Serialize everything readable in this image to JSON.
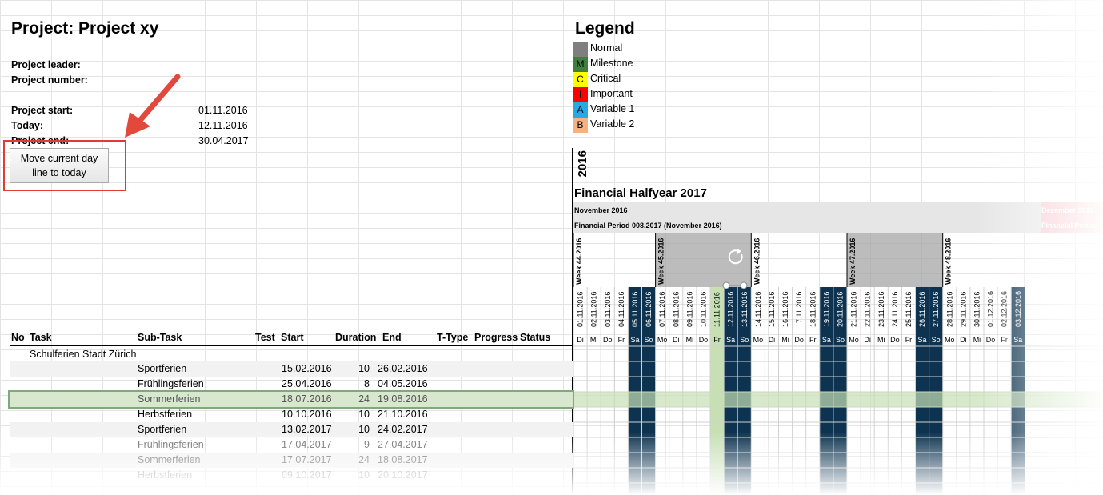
{
  "project": {
    "title": "Project: Project xy",
    "leader_label": "Project leader:",
    "number_label": "Project number:",
    "start_label": "Project start:",
    "start_value": "01.11.2016",
    "today_label": "Today:",
    "today_value": "12.11.2016",
    "end_label": "Project end:",
    "end_value": "30.04.2017"
  },
  "button": {
    "line1": "Move current day",
    "line2": "line to today"
  },
  "legend": {
    "title": "Legend",
    "items": [
      {
        "code": "",
        "label": "Normal",
        "color": "#7f7f7f"
      },
      {
        "code": "M",
        "label": "Milestone",
        "color": "#3e7f3e"
      },
      {
        "code": "C",
        "label": "Critical",
        "color": "#ffff00"
      },
      {
        "code": "I",
        "label": "Important",
        "color": "#ff0000"
      },
      {
        "code": "A",
        "label": "Variable 1",
        "color": "#2aa9e0"
      },
      {
        "code": "B",
        "label": "Variable 2",
        "color": "#f4b183"
      }
    ]
  },
  "gantt": {
    "year": "2016",
    "halfyear": "Financial Halfyear 2017",
    "month": "November 2016",
    "month_next": "Dezember 2016",
    "period": "Financial Period 008.2017 (November 2016)",
    "period_next": "Financial Period",
    "weeks": [
      "Week 44.2016",
      "Week 45.2016",
      "Week 46.2016",
      "Week 47.2016",
      "Week 48.2016"
    ],
    "dates": [
      "01.11.2016",
      "02.11.2016",
      "03.11.2016",
      "04.11.2016",
      "05.11.2016",
      "06.11.2016",
      "07.11.2016",
      "08.11.2016",
      "09.11.2016",
      "10.11.2016",
      "11.11.2016",
      "12.11.2016",
      "13.11.2016",
      "14.11.2016",
      "15.11.2016",
      "16.11.2016",
      "17.11.2016",
      "18.11.2016",
      "19.11.2016",
      "20.11.2016",
      "21.11.2016",
      "22.11.2016",
      "23.11.2016",
      "24.11.2016",
      "25.11.2016",
      "26.11.2016",
      "27.11.2016",
      "28.11.2016",
      "29.11.2016",
      "30.11.2016",
      "01.12.2016",
      "02.12.2016",
      "03.12.2016"
    ],
    "days": [
      "Di",
      "Mi",
      "Do",
      "Fr",
      "Sa",
      "So",
      "Mo",
      "Di",
      "Mi",
      "Do",
      "Fr",
      "Sa",
      "So",
      "Mo",
      "Di",
      "Mi",
      "Do",
      "Fr",
      "Sa",
      "So",
      "Mo",
      "Di",
      "Mi",
      "Do",
      "Fr",
      "Sa",
      "So",
      "Mo",
      "Di",
      "Mi",
      "Do",
      "Fr",
      "Sa"
    ],
    "weekend_color": "#0d3350",
    "today_color": "#c6e0b4",
    "week_shade_color": "#a6a6a6"
  },
  "table": {
    "headers": {
      "no": "No",
      "task": "Task",
      "subtask": "Sub-Task",
      "test": "Test",
      "start": "Start",
      "duration": "Duration",
      "end": "End",
      "ttype": "T-Type",
      "progress": "Progress",
      "status": "Status"
    },
    "group": "Schulferien Stadt Zürich",
    "rows": [
      {
        "subtask": "Sportferien",
        "start": "15.02.2016",
        "duration": "10",
        "end": "26.02.2016"
      },
      {
        "subtask": "Frühlingsferien",
        "start": "25.04.2016",
        "duration": "8",
        "end": "04.05.2016"
      },
      {
        "subtask": "Sommerferien",
        "start": "18.07.2016",
        "duration": "24",
        "end": "19.08.2016"
      },
      {
        "subtask": "Herbstferien",
        "start": "10.10.2016",
        "duration": "10",
        "end": "21.10.2016"
      },
      {
        "subtask": "Sportferien",
        "start": "13.02.2017",
        "duration": "10",
        "end": "24.02.2017"
      },
      {
        "subtask": "Frühlingsferien",
        "start": "17.04.2017",
        "duration": "9",
        "end": "27.04.2017"
      },
      {
        "subtask": "Sommerferien",
        "start": "17.07.2017",
        "duration": "24",
        "end": "18.08.2017"
      },
      {
        "subtask": "Herbstferien",
        "start": "09.10.2017",
        "duration": "10",
        "end": "20.10.2017"
      }
    ]
  }
}
